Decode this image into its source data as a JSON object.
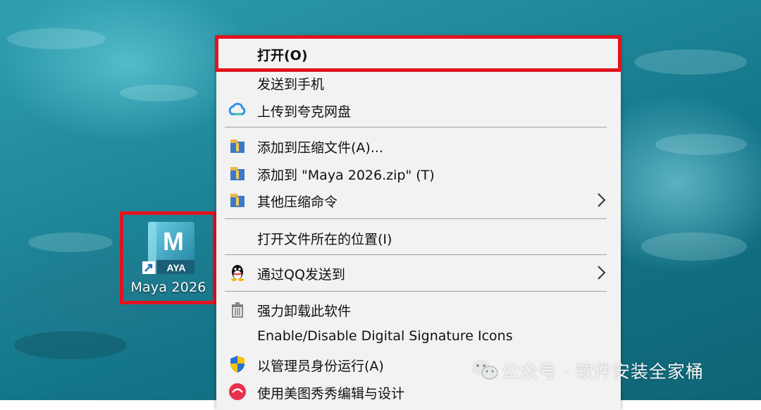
{
  "desktop": {
    "icon": {
      "label": "Maya 2026",
      "logo_letter": "M",
      "logo_text": "AYA",
      "accent_color": "#3aa9c6",
      "icon": "maya-app-shortcut-icon"
    }
  },
  "context_menu": {
    "items": [
      {
        "label": "打开(O)",
        "icon": null,
        "submenu": false,
        "bold": true
      },
      {
        "label": "发送到手机",
        "icon": null,
        "submenu": false
      },
      {
        "label": "上传到夸克网盘",
        "icon": "quark-cloud-icon",
        "submenu": false
      },
      {
        "label": "添加到压缩文件(A)...",
        "icon": "archive-icon",
        "submenu": false
      },
      {
        "label": "添加到 \"Maya 2026.zip\" (T)",
        "icon": "archive-icon",
        "submenu": false
      },
      {
        "label": "其他压缩命令",
        "icon": "archive-icon",
        "submenu": true
      },
      {
        "label": "打开文件所在的位置(I)",
        "icon": null,
        "submenu": false
      },
      {
        "label": "通过QQ发送到",
        "icon": "qq-penguin-icon",
        "submenu": true
      },
      {
        "label": "强力卸载此软件",
        "icon": "trash-can-icon",
        "submenu": false
      },
      {
        "label": "Enable/Disable Digital Signature Icons",
        "icon": null,
        "submenu": false
      },
      {
        "label": "以管理员身份运行(A)",
        "icon": "uac-shield-icon",
        "submenu": false
      },
      {
        "label": "使用美图秀秀编辑与设计",
        "icon": "meitu-icon",
        "submenu": false
      }
    ]
  },
  "watermark": {
    "text": "公众号 · 软件安装全家桶",
    "icon": "wechat-icon"
  },
  "colors": {
    "highlight": "#e0141e",
    "menu_bg": "#f2f2f2"
  }
}
